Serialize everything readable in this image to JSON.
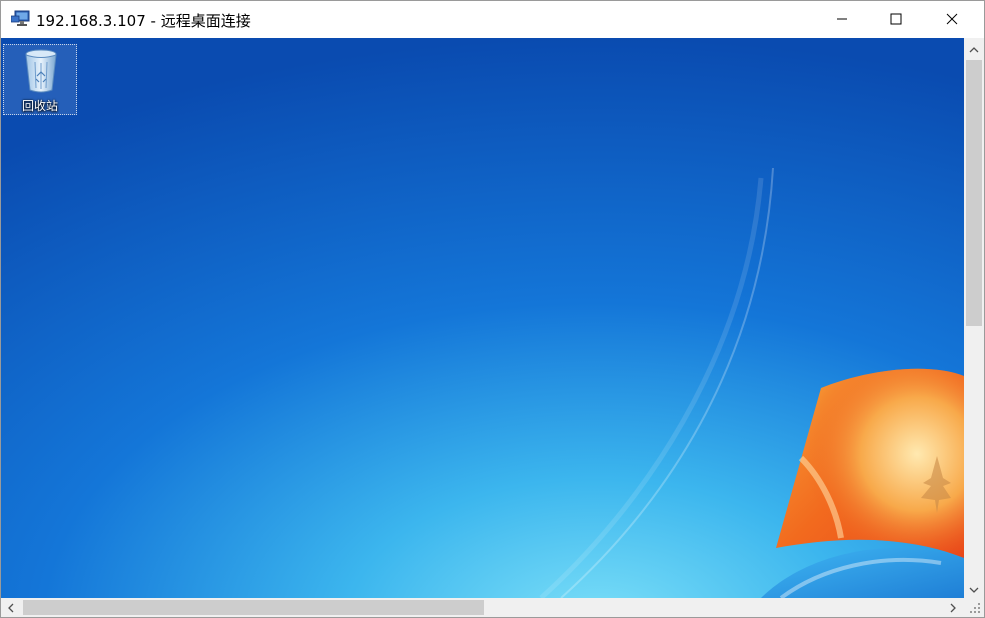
{
  "window": {
    "title": "192.168.3.107 - 远程桌面连接",
    "icon": "remote-desktop-icon",
    "controls": [
      "minimize-icon",
      "maximize-icon",
      "close-icon"
    ]
  },
  "desktop": {
    "wallpaper": "windows-7-default-wallpaper",
    "icons": [
      {
        "label": "回收站",
        "icon": "recycle-bin-icon"
      }
    ]
  },
  "scrollbars": {
    "vertical": {
      "up": "chevron-up-icon",
      "down": "chevron-down-icon"
    },
    "horizontal": {
      "left": "chevron-left-icon",
      "right": "chevron-right-icon"
    }
  },
  "colors": {
    "titlebar": "#ffffff",
    "wallpaper_dark": "#0a4fb4",
    "wallpaper_light": "#5fd0f2",
    "scrollbar_track": "#f0f0f0",
    "scrollbar_thumb": "#cdcdcd"
  }
}
